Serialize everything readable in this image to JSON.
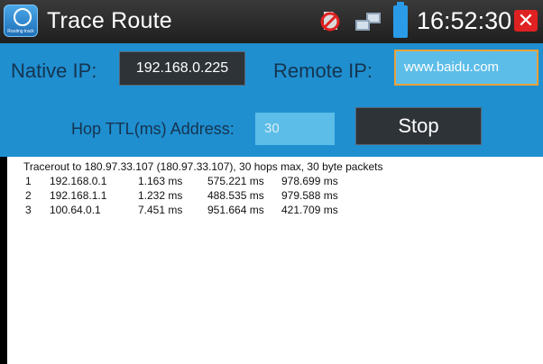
{
  "titlebar": {
    "app_icon": "routing-track-app-icon",
    "app_icon_caption": "Routing track",
    "title": "Trace Route",
    "status_icons": [
      "no-sd-card-icon",
      "network-icon",
      "battery-icon"
    ],
    "time": "16:52:30",
    "close_label": "✕"
  },
  "panel": {
    "native_ip_label": "Native IP:",
    "native_ip_value": "192.168.0.225",
    "remote_ip_label": "Remote IP:",
    "remote_ip_value": "www.baidu.com",
    "hop_label": "Hop TTL(ms) Address:",
    "hop_value": "30",
    "stop_label": "Stop"
  },
  "output": {
    "header": "Tracerout to 180.97.33.107 (180.97.33.107), 30 hops max, 30 byte packets",
    "hops": [
      {
        "num": "1",
        "ip": "192.168.0.1",
        "t1": "1.163 ms",
        "t2": "575.221 ms",
        "t3": "978.699 ms"
      },
      {
        "num": "2",
        "ip": "192.168.1.1",
        "t1": "1.232 ms",
        "t2": "488.535 ms",
        "t3": "979.588 ms"
      },
      {
        "num": "3",
        "ip": "100.64.0.1",
        "t1": "7.451 ms",
        "t2": "951.664 ms",
        "t3": "421.709 ms"
      }
    ]
  },
  "colors": {
    "titlebar": "#2b2b2b",
    "panel": "#1f8fd0",
    "field_dark": "#2e3338",
    "field_light": "#5cbde8",
    "focus_border": "#e8a23a",
    "close": "#e02121",
    "battery": "#2a9be8"
  }
}
